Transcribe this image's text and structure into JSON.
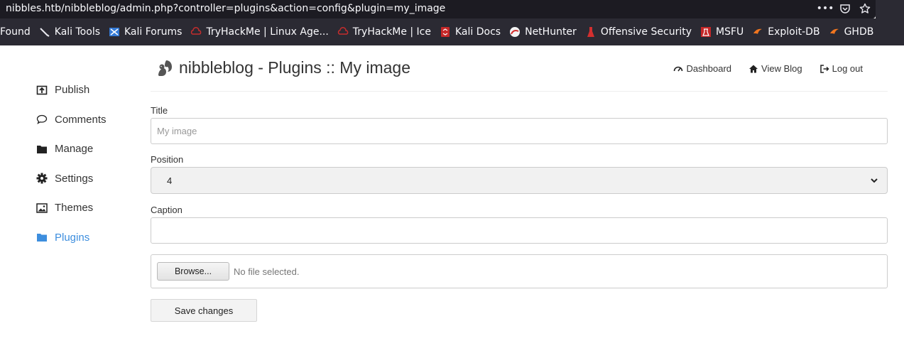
{
  "browser": {
    "url": "nibbles.htb/nibbleblog/admin.php?controller=plugins&action=config&plugin=my_image",
    "actions": {
      "more": "•••",
      "pocket": "pocket-icon",
      "bookmark": "star-icon"
    }
  },
  "bookmarks": [
    {
      "label": "Found",
      "icon": ""
    },
    {
      "label": "Kali Tools",
      "icon": "kali-tools-icon"
    },
    {
      "label": "Kali Forums",
      "icon": "kali-forums-icon"
    },
    {
      "label": "TryHackMe | Linux Age...",
      "icon": "tryhackme-icon"
    },
    {
      "label": "TryHackMe | Ice",
      "icon": "tryhackme-icon"
    },
    {
      "label": "Kali Docs",
      "icon": "kali-docs-icon"
    },
    {
      "label": "NetHunter",
      "icon": "nethunter-icon"
    },
    {
      "label": "Offensive Security",
      "icon": "offsec-icon"
    },
    {
      "label": "MSFU",
      "icon": "msfu-icon"
    },
    {
      "label": "Exploit-DB",
      "icon": "exploitdb-icon"
    },
    {
      "label": "GHDB",
      "icon": "ghdb-icon"
    }
  ],
  "sidebar": {
    "items": [
      {
        "label": "Publish",
        "icon": "publish-icon"
      },
      {
        "label": "Comments",
        "icon": "comment-icon"
      },
      {
        "label": "Manage",
        "icon": "folder-icon"
      },
      {
        "label": "Settings",
        "icon": "gear-icon"
      },
      {
        "label": "Themes",
        "icon": "image-icon"
      },
      {
        "label": "Plugins",
        "icon": "folder-open-icon"
      }
    ]
  },
  "header": {
    "title": "nibbleblog - Plugins :: My image",
    "nav": [
      {
        "label": "Dashboard",
        "icon": "dashboard-icon"
      },
      {
        "label": "View Blog",
        "icon": "home-icon"
      },
      {
        "label": "Log out",
        "icon": "logout-icon"
      }
    ]
  },
  "form": {
    "title_label": "Title",
    "title_placeholder": "My image",
    "position_label": "Position",
    "position_value": "4",
    "caption_label": "Caption",
    "caption_value": "",
    "browse_label": "Browse...",
    "file_status": "No file selected.",
    "save_label": "Save changes"
  },
  "colors": {
    "accent": "#3d8ede",
    "chrome_bg": "#2b2a33",
    "urlbar_bg": "#1c1b22",
    "text": "#333333"
  }
}
